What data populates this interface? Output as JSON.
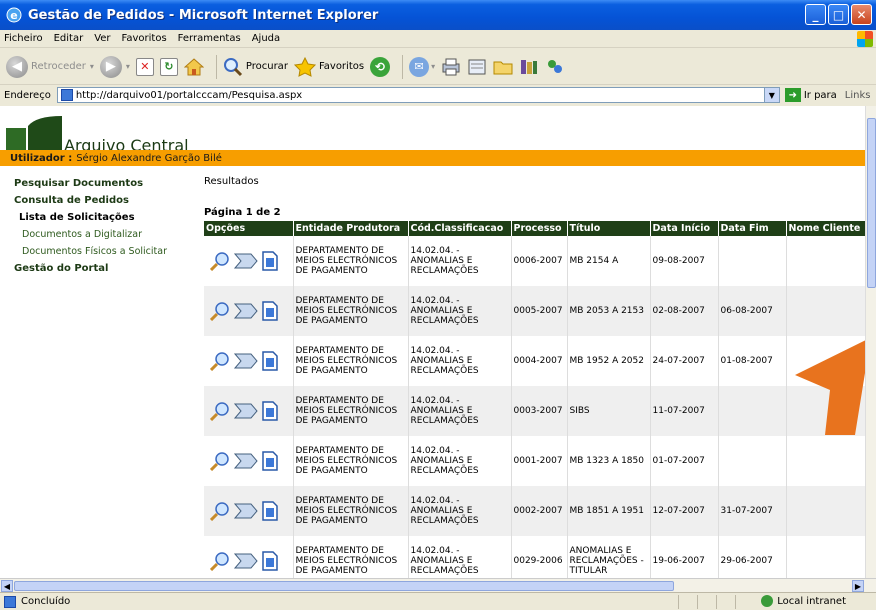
{
  "window": {
    "title": "Gestão de Pedidos - Microsoft Internet Explorer"
  },
  "menu": [
    "Ficheiro",
    "Editar",
    "Ver",
    "Favoritos",
    "Ferramentas",
    "Ajuda"
  ],
  "toolbar": {
    "back": "Retroceder",
    "search": "Procurar",
    "favorites": "Favoritos"
  },
  "address": {
    "label": "Endereço",
    "url": "http://darquivo01/portalcccam/Pesquisa.aspx",
    "go": "Ir para",
    "links": "Links"
  },
  "header": {
    "logo_text": "Arquivo Central",
    "user_label": "Utilizador :",
    "user_name": "Sérgio Alexandre Garção Bilé"
  },
  "sidebar": {
    "items": [
      {
        "label": "Pesquisar Documentos",
        "kind": "top"
      },
      {
        "label": "Consulta de Pedidos",
        "kind": "top"
      },
      {
        "label": "Lista de Solicitações",
        "kind": "sub"
      },
      {
        "label": "Documentos a Digitalizar",
        "kind": "link"
      },
      {
        "label": "Documentos Físicos a Solicitar",
        "kind": "link"
      },
      {
        "label": "Gestão do Portal",
        "kind": "top"
      }
    ]
  },
  "main": {
    "results_label": "Resultados",
    "pager": "Página 1 de 2",
    "columns": [
      "Opções",
      "Entidade Produtora",
      "Cód.Classificacao",
      "Processo",
      "Título",
      "Data Início",
      "Data Fim",
      "Nome Cliente"
    ],
    "rows": [
      {
        "entity": "DEPARTAMENTO DE MEIOS ELECTRÓNICOS DE PAGAMENTO",
        "code": "14.02.04. - ANOMALIAS E RECLAMAÇÕES",
        "process": "0006-2007",
        "title": "MB 2154 A",
        "start": "09-08-2007",
        "end": "",
        "client": ""
      },
      {
        "entity": "DEPARTAMENTO DE MEIOS ELECTRÓNICOS DE PAGAMENTO",
        "code": "14.02.04. - ANOMALIAS E RECLAMAÇÕES",
        "process": "0005-2007",
        "title": "MB 2053 A 2153",
        "start": "02-08-2007",
        "end": "06-08-2007",
        "client": ""
      },
      {
        "entity": "DEPARTAMENTO DE MEIOS ELECTRÓNICOS DE PAGAMENTO",
        "code": "14.02.04. - ANOMALIAS E RECLAMAÇÕES",
        "process": "0004-2007",
        "title": "MB 1952 A 2052",
        "start": "24-07-2007",
        "end": "01-08-2007",
        "client": ""
      },
      {
        "entity": "DEPARTAMENTO DE MEIOS ELECTRÓNICOS DE PAGAMENTO",
        "code": "14.02.04. - ANOMALIAS E RECLAMAÇÕES",
        "process": "0003-2007",
        "title": "SIBS",
        "start": "11-07-2007",
        "end": "",
        "client": ""
      },
      {
        "entity": "DEPARTAMENTO DE MEIOS ELECTRÓNICOS DE PAGAMENTO",
        "code": "14.02.04. - ANOMALIAS E RECLAMAÇÕES",
        "process": "0001-2007",
        "title": "MB 1323 A 1850",
        "start": "01-07-2007",
        "end": "",
        "client": ""
      },
      {
        "entity": "DEPARTAMENTO DE MEIOS ELECTRÓNICOS DE PAGAMENTO",
        "code": "14.02.04. - ANOMALIAS E RECLAMAÇÕES",
        "process": "0002-2007",
        "title": "MB 1851 A 1951",
        "start": "12-07-2007",
        "end": "31-07-2007",
        "client": ""
      },
      {
        "entity": "DEPARTAMENTO DE MEIOS ELECTRÓNICOS DE PAGAMENTO",
        "code": "14.02.04. - ANOMALIAS E RECLAMAÇÕES",
        "process": "0029-2006",
        "title": "ANOMALIAS E RECLAMAÇÕES - TITULAR",
        "start": "19-06-2007",
        "end": "29-06-2007",
        "client": ""
      }
    ]
  },
  "status": {
    "text": "Concluído",
    "zone": "Local intranet"
  },
  "colors": {
    "brand_dark": "#1f3f17",
    "brand_green": "#2e6b25",
    "orange": "#f79e00",
    "annotation_arrow": "#e8731e"
  }
}
